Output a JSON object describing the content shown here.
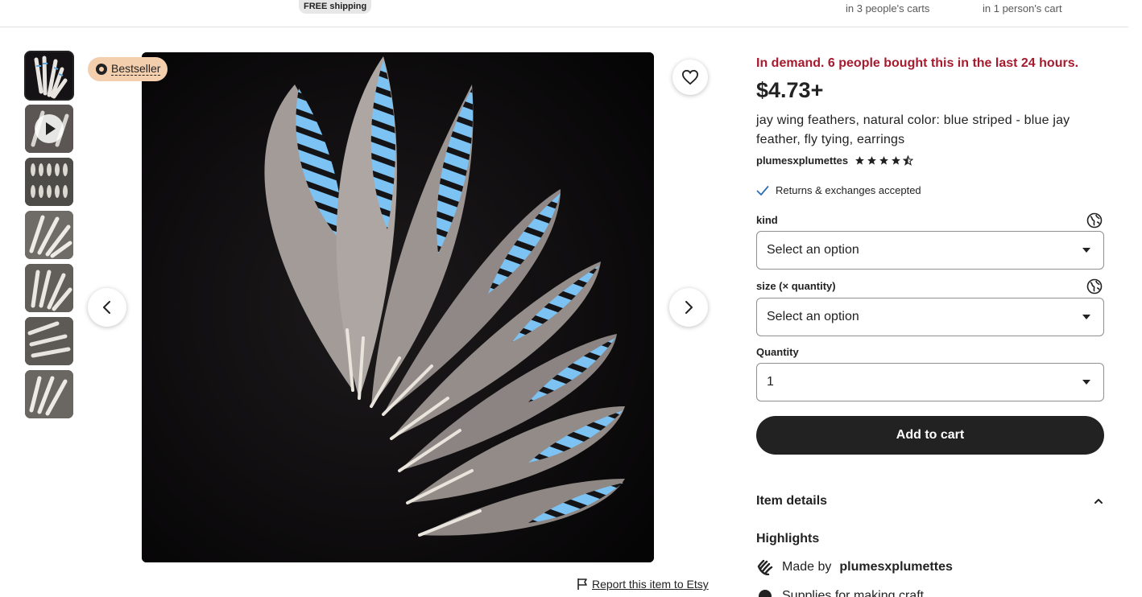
{
  "topbar": {
    "free_shipping": "FREE shipping",
    "carts_a": "in 3 people's carts",
    "carts_b": "in 1 person's cart"
  },
  "gallery": {
    "badge": "Bestseller",
    "thumbnail_count": 7,
    "report_link": "Report this item to Etsy"
  },
  "listing": {
    "demand": "In demand. 6 people bought this in the last 24 hours.",
    "price": "$4.73+",
    "title": "jay wing feathers, natural color: blue striped - blue jay feather, fly tying, earrings",
    "shop_name": "plumesxplumettes",
    "rating": 4.5,
    "returns": "Returns & exchanges accepted"
  },
  "options": {
    "kind_label": "kind",
    "kind_value": "Select an option",
    "size_label": "size (× quantity)",
    "size_value": "Select an option",
    "quantity_label": "Quantity",
    "quantity_value": "1"
  },
  "actions": {
    "add_to_cart": "Add to cart"
  },
  "details": {
    "item_details": "Item details",
    "highlights": "Highlights",
    "made_by_prefix": "Made by",
    "made_by_shop": "plumesxplumettes",
    "row2_partial": "Supplies for making craft..."
  },
  "colors": {
    "demand_red": "#a61a2e",
    "badge_bg": "#f4cfae",
    "button_dark": "#222222"
  }
}
